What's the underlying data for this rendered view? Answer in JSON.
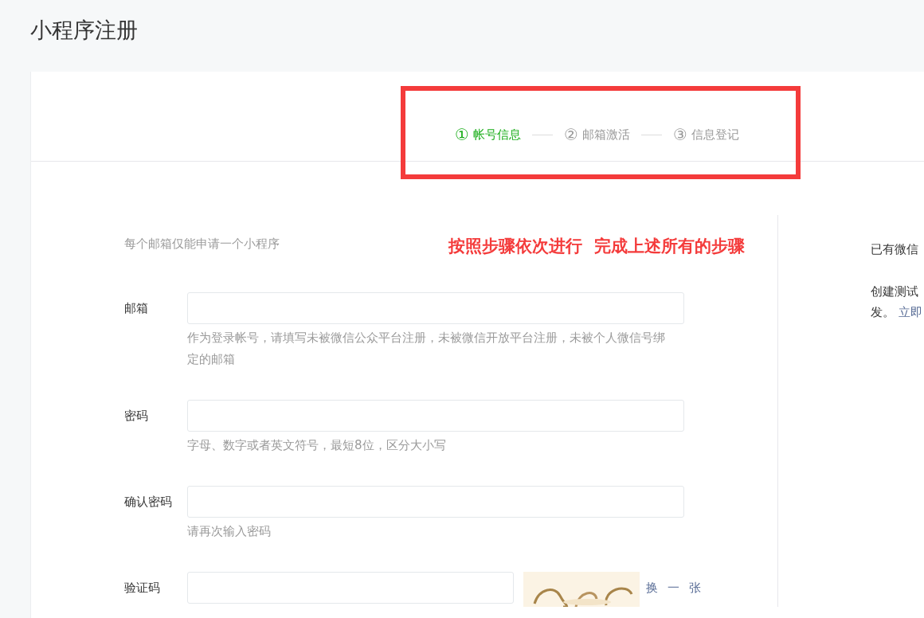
{
  "page": {
    "title": "小程序注册"
  },
  "steps": [
    {
      "number": "①",
      "label": "帐号信息",
      "selected": true
    },
    {
      "number": "②",
      "label": "邮箱激活",
      "selected": false
    },
    {
      "number": "③",
      "label": "信息登记",
      "selected": false
    }
  ],
  "notice": "每个邮箱仅能申请一个小程序",
  "annotation": {
    "text": "按照步骤依次进行  完成上述所有的步骤"
  },
  "fields": [
    {
      "kind": "text",
      "label": "邮箱",
      "hint": "作为登录帐号，请填写未被微信公众平台注册，未被微信开放平台注册，未被个人微信号绑定的邮箱"
    },
    {
      "kind": "text",
      "label": "密码",
      "hint": "字母、数字或者英文符号，最短8位，区分大小写"
    },
    {
      "kind": "text",
      "label": "确认密码",
      "hint": "请再次输入密码"
    },
    {
      "kind": "captcha",
      "label": "验证码",
      "refresh": "换一张"
    }
  ],
  "side": {
    "existing": "已有微信",
    "test_text": "创建测试",
    "test_text2": "发。",
    "test_link": "立即"
  }
}
